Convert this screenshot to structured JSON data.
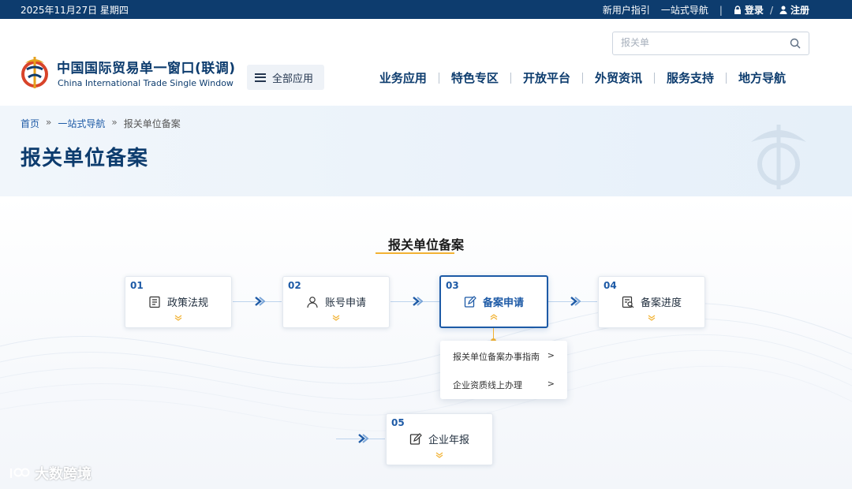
{
  "topbar": {
    "date": "2025年11月27日 星期四",
    "guide": "新用户指引",
    "onestop": "一站式导航",
    "separator": "|",
    "login": "登录",
    "slash": "/",
    "register": "注册"
  },
  "header": {
    "brand_cn": "中国国际贸易单一窗口(联调)",
    "brand_en": "China International Trade Single Window",
    "all_apps": "全部应用",
    "search_placeholder": "报关单",
    "nav": [
      "业务应用",
      "特色专区",
      "开放平台",
      "外贸资讯",
      "服务支持",
      "地方导航"
    ]
  },
  "breadcrumb": {
    "home": "首页",
    "onestop": "一站式导航",
    "current": "报关单位备案",
    "arrow": "»"
  },
  "page_title": "报关单位备案",
  "section_title": "报关单位备案",
  "steps": [
    {
      "num": "01",
      "label": "政策法规",
      "icon": "document-list-icon"
    },
    {
      "num": "02",
      "label": "账号申请",
      "icon": "user-icon"
    },
    {
      "num": "03",
      "label": "备案申请",
      "icon": "edit-icon"
    },
    {
      "num": "04",
      "label": "备案进度",
      "icon": "search-document-icon"
    },
    {
      "num": "05",
      "label": "企业年报",
      "icon": "edit-icon"
    }
  ],
  "dropdown": [
    {
      "label": "报关单位备案办事指南",
      "arrow": ">"
    },
    {
      "label": "企业资质线上办理",
      "arrow": ">"
    }
  ],
  "watermark": "大数跨境",
  "colors": {
    "primary": "#0d3c6e",
    "accent": "#1d5aa6",
    "highlight": "#f2b233"
  }
}
